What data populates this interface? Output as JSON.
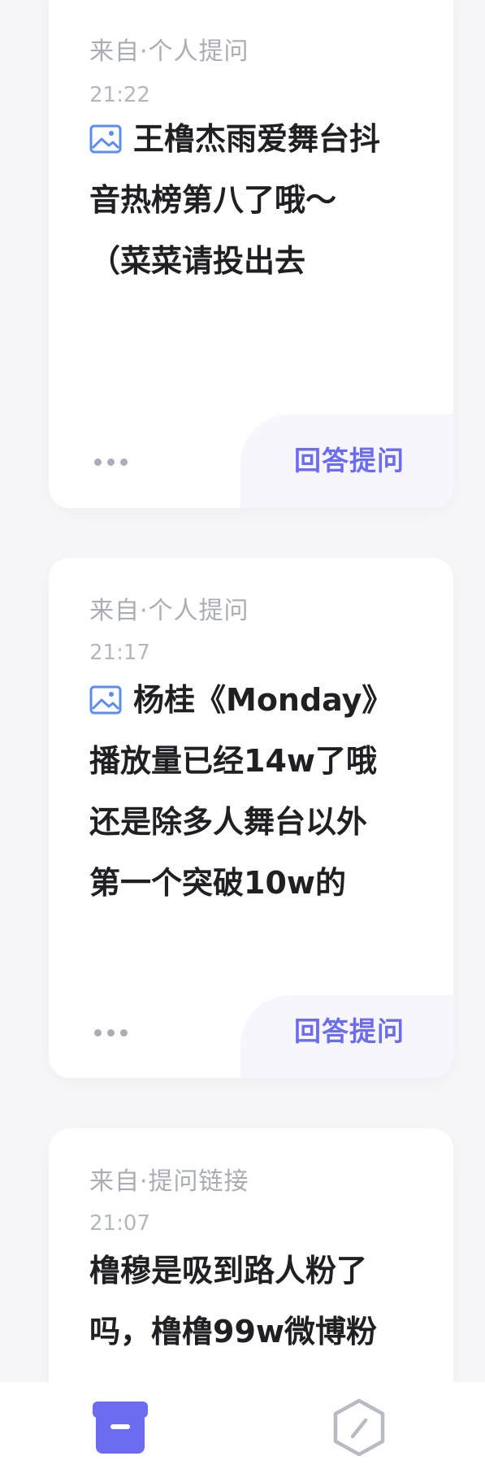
{
  "cards": [
    {
      "source": "来自·个人提问",
      "time": "21:22",
      "has_image": true,
      "lines": [
        "王橹杰雨爱舞台抖",
        "音热榜第八了哦～",
        "（菜菜请投出去"
      ],
      "answer_label": "回答提问"
    },
    {
      "source": "来自·个人提问",
      "time": "21:17",
      "has_image": true,
      "lines": [
        "杨桂《Monday》",
        "播放量已经14w了哦",
        "还是除多人舞台以外",
        "第一个突破10w的"
      ],
      "answer_label": "回答提问"
    },
    {
      "source": "来自·提问链接",
      "time": "21:07",
      "has_image": false,
      "lines": [
        "橹穆是吸到路人粉了",
        "吗，橹橹99w微博粉"
      ]
    }
  ],
  "icons": {
    "image_icon": "image-icon",
    "more_icon": "more-dots-icon",
    "tab_inbox_icon": "inbox-box-icon",
    "tab_edit_icon": "hexagon-edit-icon"
  },
  "colors": {
    "accent": "#6c6cf0",
    "icon_blue": "#5b8cf0",
    "muted": "#a9adb6"
  }
}
